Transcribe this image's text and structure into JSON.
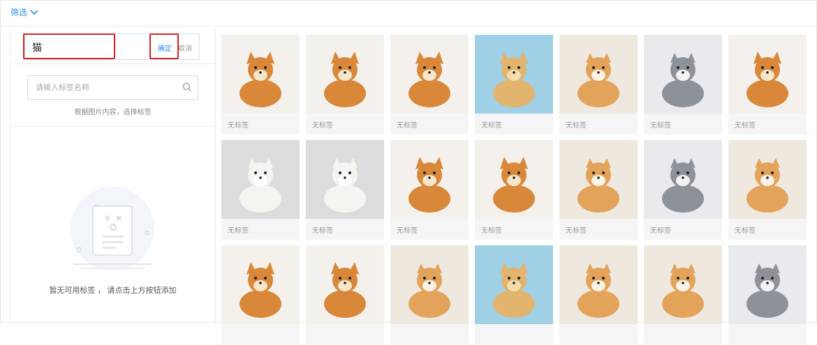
{
  "topbar": {
    "filter_label": "筛选"
  },
  "left_panel": {
    "search": {
      "value": "猫",
      "confirm_label": "确定",
      "cancel_label": "取消"
    },
    "tag_search": {
      "placeholder": "请输入标签名称",
      "hint": "根据图片内容，选择标签"
    },
    "empty": {
      "text": "暂无可用标签 ， 请点击上方按钮添加"
    }
  },
  "images": [
    {
      "subject": "shiba-sitting",
      "label": "无标签"
    },
    {
      "subject": "shiba-lying",
      "label": "无标签"
    },
    {
      "subject": "shiba-with-toys",
      "label": "无标签"
    },
    {
      "subject": "golden-puppy",
      "label": "无标签"
    },
    {
      "subject": "cat-in-basket",
      "label": "无标签"
    },
    {
      "subject": "gray-cat-balcony",
      "label": "无标签"
    },
    {
      "subject": "shiba-on-grass",
      "label": "无标签"
    },
    {
      "subject": "white-cat-lying",
      "label": "无标签"
    },
    {
      "subject": "orange-white-cat-sitting",
      "label": "无标签"
    },
    {
      "subject": "shiba-lying-2",
      "label": "无标签"
    },
    {
      "subject": "corgi-by-pool",
      "label": "无标签"
    },
    {
      "subject": "orange-cat-face",
      "label": "无标签"
    },
    {
      "subject": "gray-white-cat",
      "label": "无标签"
    },
    {
      "subject": "kitten-playing",
      "label": "无标签"
    },
    {
      "subject": "two-shibas",
      "label": ""
    },
    {
      "subject": "shiba-closeup",
      "label": ""
    },
    {
      "subject": "orange-cat-lying",
      "label": ""
    },
    {
      "subject": "two-golden-puppies",
      "label": ""
    },
    {
      "subject": "tabby-cat-sitting",
      "label": ""
    },
    {
      "subject": "kitten-in-blanket",
      "label": ""
    },
    {
      "subject": "gray-kitten",
      "label": ""
    }
  ],
  "colors": {
    "accent": "#2d8cf0",
    "highlight": "#e02020"
  }
}
